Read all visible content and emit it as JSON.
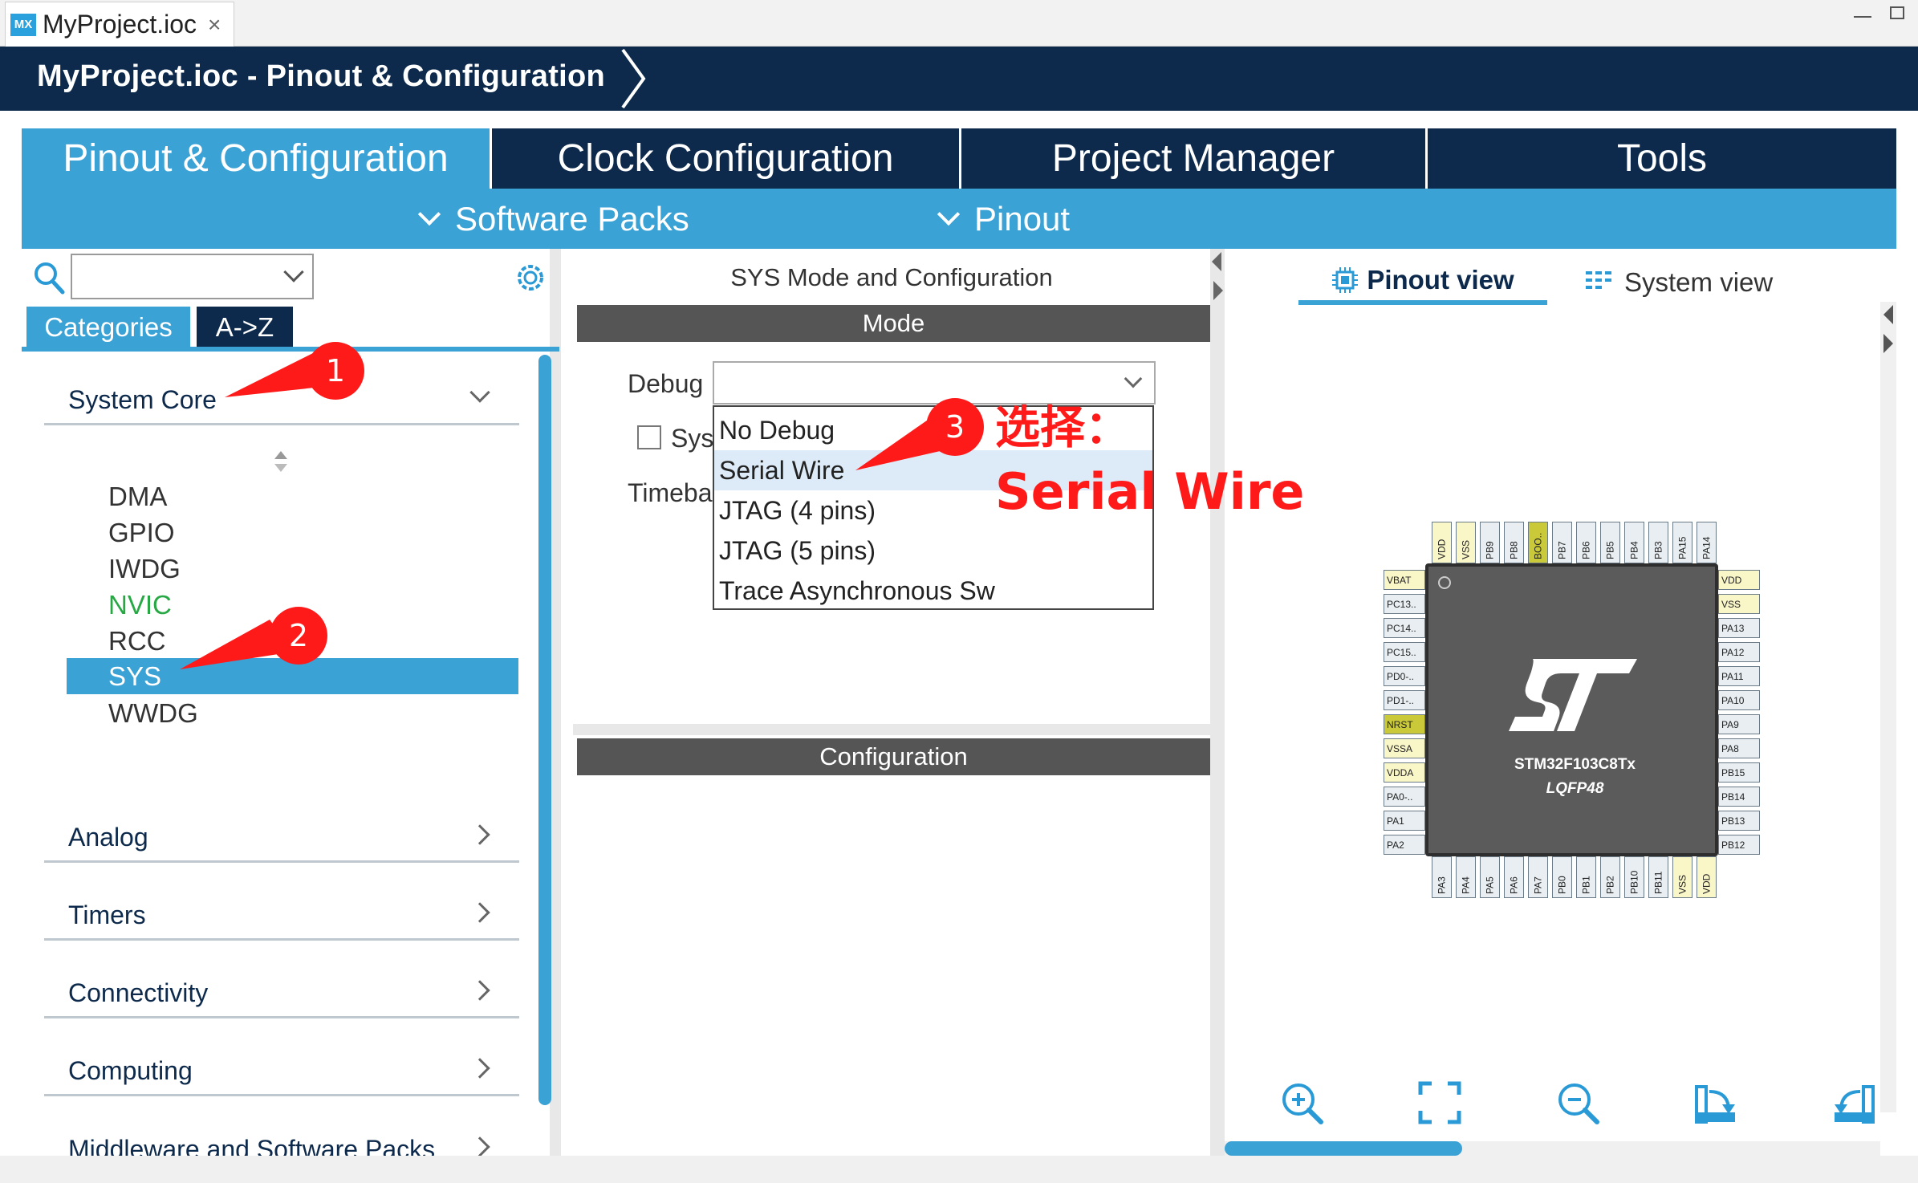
{
  "file_tab": {
    "name": "MyProject.ioc",
    "icon": "MX",
    "close": "×"
  },
  "breadcrumb": {
    "title": "MyProject.ioc - Pinout & Configuration"
  },
  "main_tabs": [
    {
      "label": "Pinout & Configuration",
      "active": true
    },
    {
      "label": "Clock Configuration",
      "active": false
    },
    {
      "label": "Project Manager",
      "active": false
    },
    {
      "label": "Tools",
      "active": false
    }
  ],
  "sub_toolbar": {
    "software_packs": "Software Packs",
    "pinout": "Pinout"
  },
  "left_panel": {
    "search_value": "",
    "tabs": [
      "Categories",
      "A->Z"
    ],
    "sections": {
      "system_core": "System Core",
      "analog": "Analog",
      "timers": "Timers",
      "connectivity": "Connectivity",
      "computing": "Computing",
      "middleware": "Middleware and Software Packs"
    },
    "system_core_items": [
      "DMA",
      "GPIO",
      "IWDG",
      "NVIC",
      "RCC",
      "SYS",
      "WWDG"
    ],
    "selected_item": "SYS"
  },
  "middle_panel": {
    "title": "SYS Mode and Configuration",
    "mode_header": "Mode",
    "debug_label": "Debug",
    "sys_label": "Sys",
    "timebase_label": "Timeba",
    "config_header": "Configuration",
    "debug_value": "",
    "debug_options": [
      "No Debug",
      "Serial Wire",
      "JTAG (4 pins)",
      "JTAG (5 pins)",
      "Trace Asynchronous Sw"
    ],
    "highlighted_option": "Serial Wire"
  },
  "right_panel": {
    "pinout_view": "Pinout view",
    "system_view": "System view",
    "chip": {
      "part": "STM32F103C8Tx",
      "package": "LQFP48",
      "top_pins": [
        "VDD",
        "VSS",
        "PB9",
        "PB8",
        "BOO..",
        "PB7",
        "PB6",
        "PB5",
        "PB4",
        "PB3",
        "PA15",
        "PA14"
      ],
      "bottom_pins": [
        "PA3",
        "PA4",
        "PA5",
        "PA6",
        "PA7",
        "PB0",
        "PB1",
        "PB2",
        "PB10",
        "PB11",
        "VSS",
        "VDD"
      ],
      "left_pins": [
        "VBAT",
        "PC13..",
        "PC14..",
        "PC15..",
        "PD0-..",
        "PD1-..",
        "NRST",
        "VSSA",
        "VDDA",
        "PA0-..",
        "PA1",
        "PA2"
      ],
      "right_pins": [
        "VDD",
        "VSS",
        "PA13",
        "PA12",
        "PA11",
        "PA10",
        "PA9",
        "PA8",
        "PB15",
        "PB14",
        "PB13",
        "PB12"
      ]
    },
    "tools": [
      "zoom-in-icon",
      "fit-screen-icon",
      "zoom-out-icon",
      "rotate-right-icon",
      "rotate-left-icon"
    ]
  },
  "annotations": {
    "callout_1": "1",
    "callout_2": "2",
    "callout_3": "3",
    "note_line1": "选择：",
    "note_line2": "Serial Wire"
  },
  "colors": {
    "navy": "#0d2a4c",
    "accent_blue": "#3ba2d6",
    "header_gray": "#555555",
    "annotation_red": "#ff1a1a",
    "nvic_green": "#27a844"
  }
}
